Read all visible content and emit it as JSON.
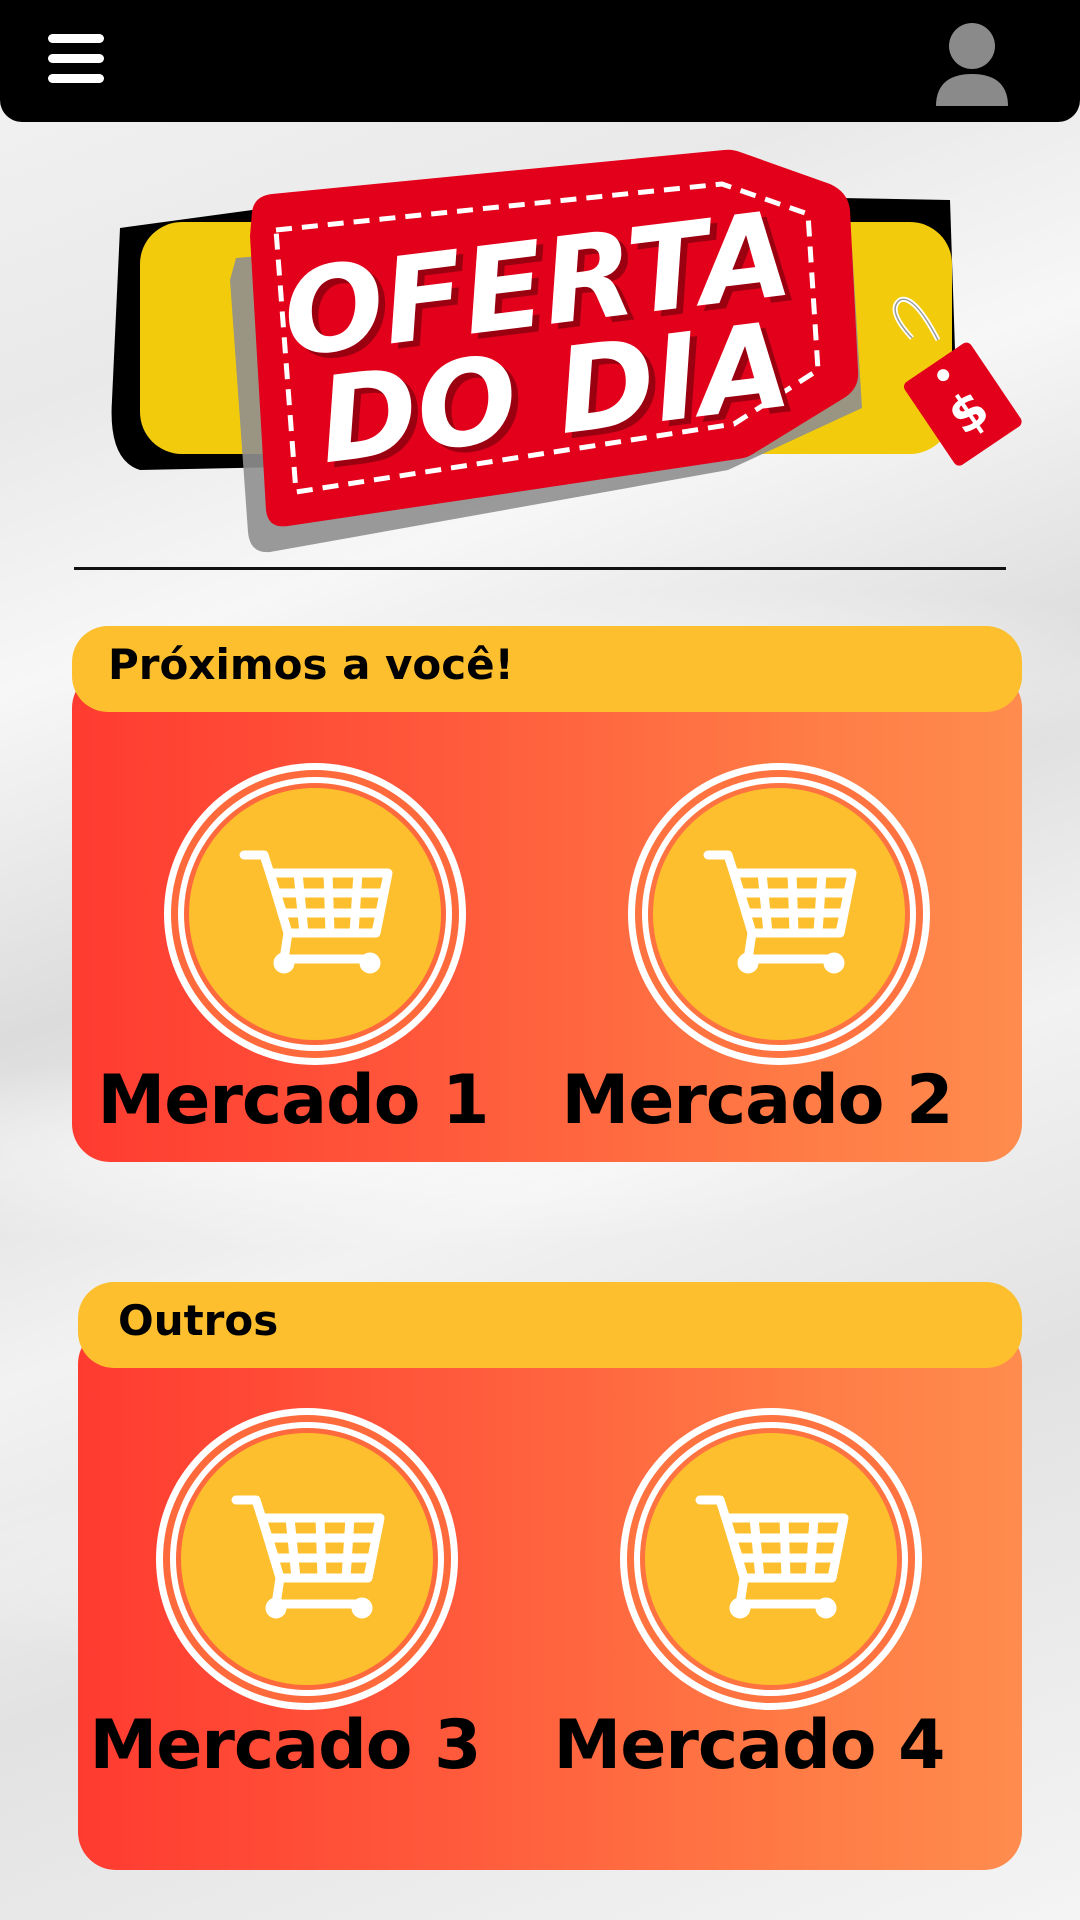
{
  "header": {
    "menu_icon": "hamburger-menu-icon",
    "profile_icon": "user-avatar-icon"
  },
  "hero": {
    "line1": "OFERTA",
    "line2": "DO DIA",
    "tag_symbol": "$",
    "colors": {
      "red": "#e3001b",
      "yellow": "#f2cc0c",
      "black": "#000000"
    }
  },
  "sections": [
    {
      "title": "Próximos a você!",
      "markets": [
        {
          "label": "Mercado 1",
          "icon": "shopping-cart-icon"
        },
        {
          "label": "Mercado 2",
          "icon": "shopping-cart-icon"
        }
      ]
    },
    {
      "title": "Outros",
      "markets": [
        {
          "label": "Mercado 3",
          "icon": "shopping-cart-icon"
        },
        {
          "label": "Mercado 4",
          "icon": "shopping-cart-icon"
        }
      ]
    }
  ],
  "colors": {
    "header_bg": "#000000",
    "section_header": "#fdbf2d",
    "section_gradient_start": "#ff3b30",
    "section_gradient_end": "#ff8c4e",
    "circle_fill": "#fdbf2d"
  }
}
